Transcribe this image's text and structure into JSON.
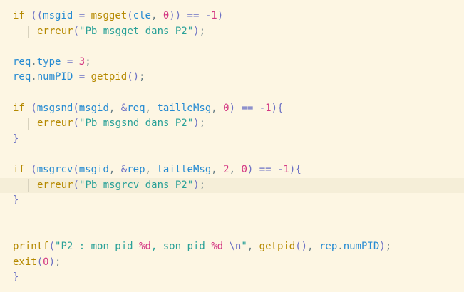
{
  "editor": {
    "language": "C",
    "lines": [
      {
        "text": "if ((msgid = msgget(cle, 0)) == -1)"
      },
      {
        "text": "    erreur(\"Pb msgget dans P2\");"
      },
      {
        "text": ""
      },
      {
        "text": "req.type = 3;"
      },
      {
        "text": "req.numPID = getpid();"
      },
      {
        "text": ""
      },
      {
        "text": "if (msgsnd(msgid, &req, tailleMsg, 0) == -1){"
      },
      {
        "text": "    erreur(\"Pb msgsnd dans P2\");"
      },
      {
        "text": "}"
      },
      {
        "text": ""
      },
      {
        "text": "if (msgrcv(msgid, &rep, tailleMsg, 2, 0) == -1){"
      },
      {
        "text": "    erreur(\"Pb msgrcv dans P2\");"
      },
      {
        "text": "}"
      },
      {
        "text": ""
      },
      {
        "text": ""
      },
      {
        "text": "printf(\"P2 : mon pid %d, son pid %d \\n\", getpid(), rep.numPID);"
      },
      {
        "text": "exit(0);"
      },
      {
        "text": "}"
      }
    ],
    "highlighted_line": 12,
    "colors": {
      "background": "#fdf6e3",
      "keyword": "#859900",
      "function": "#b58900",
      "variable": "#268bd2",
      "number": "#d33682",
      "string": "#2aa198",
      "operator": "#6c71c4",
      "current_line": "#f5eed8"
    }
  }
}
